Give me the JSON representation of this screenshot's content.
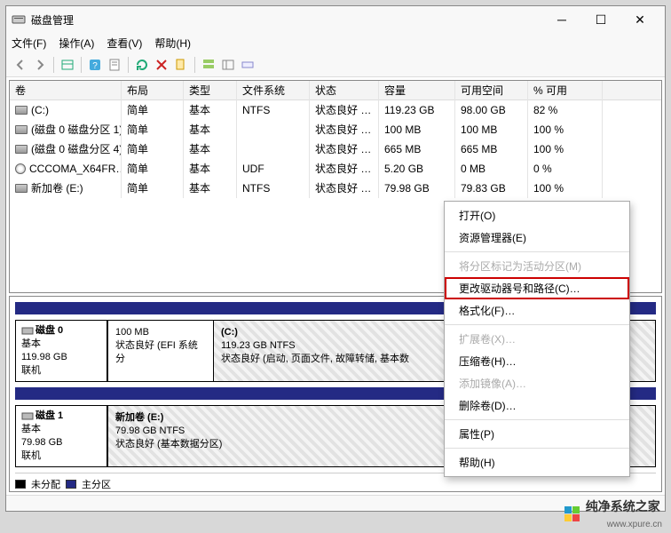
{
  "title": "磁盘管理",
  "menus": [
    "文件(F)",
    "操作(A)",
    "查看(V)",
    "帮助(H)"
  ],
  "table_headers": [
    "卷",
    "布局",
    "类型",
    "文件系统",
    "状态",
    "容量",
    "可用空间",
    "% 可用"
  ],
  "volumes": [
    {
      "icon": "drive",
      "name": "(C:)",
      "layout": "简单",
      "type": "基本",
      "fs": "NTFS",
      "status": "状态良好 (…",
      "cap": "119.23 GB",
      "free": "98.00 GB",
      "pct": "82 %"
    },
    {
      "icon": "drive",
      "name": "(磁盘 0 磁盘分区 1)",
      "layout": "简单",
      "type": "基本",
      "fs": "",
      "status": "状态良好 (…",
      "cap": "100 MB",
      "free": "100 MB",
      "pct": "100 %"
    },
    {
      "icon": "drive",
      "name": "(磁盘 0 磁盘分区 4)",
      "layout": "简单",
      "type": "基本",
      "fs": "",
      "status": "状态良好 (…",
      "cap": "665 MB",
      "free": "665 MB",
      "pct": "100 %"
    },
    {
      "icon": "cd",
      "name": "CCCOMA_X64FR…",
      "layout": "简单",
      "type": "基本",
      "fs": "UDF",
      "status": "状态良好 (…",
      "cap": "5.20 GB",
      "free": "0 MB",
      "pct": "0 %"
    },
    {
      "icon": "drive",
      "name": "新加卷 (E:)",
      "layout": "简单",
      "type": "基本",
      "fs": "NTFS",
      "status": "状态良好 (…",
      "cap": "79.98 GB",
      "free": "79.83 GB",
      "pct": "100 %"
    }
  ],
  "disks": [
    {
      "label_title": "磁盘 0",
      "label_type": "基本",
      "label_size": "119.98 GB",
      "label_status": "联机",
      "parts": [
        {
          "cls": "p1",
          "title": "",
          "sub1": "100 MB",
          "sub2": "状态良好 (EFI 系统分"
        },
        {
          "cls": "p2 hatch",
          "title": "(C:)",
          "sub1": "119.23 GB NTFS",
          "sub2": "状态良好 (启动, 页面文件, 故障转储, 基本数"
        }
      ]
    },
    {
      "label_title": "磁盘 1",
      "label_type": "基本",
      "label_size": "79.98 GB",
      "label_status": "联机",
      "parts": [
        {
          "cls": "p2 hatch",
          "title": "新加卷  (E:)",
          "sub1": "79.98 GB NTFS",
          "sub2": "状态良好 (基本数据分区)"
        }
      ]
    }
  ],
  "legend": {
    "unalloc": "未分配",
    "primary": "主分区"
  },
  "context_menu": [
    {
      "t": "打开(O)"
    },
    {
      "t": "资源管理器(E)"
    },
    {
      "sep": true
    },
    {
      "t": "将分区标记为活动分区(M)",
      "dis": true
    },
    {
      "t": "更改驱动器号和路径(C)…",
      "hl": true
    },
    {
      "t": "格式化(F)…"
    },
    {
      "sep": true
    },
    {
      "t": "扩展卷(X)…",
      "dis": true
    },
    {
      "t": "压缩卷(H)…"
    },
    {
      "t": "添加镜像(A)…",
      "dis": true
    },
    {
      "t": "删除卷(D)…"
    },
    {
      "sep": true
    },
    {
      "t": "属性(P)"
    },
    {
      "sep": true
    },
    {
      "t": "帮助(H)"
    }
  ],
  "watermark": {
    "name": "纯净系统之家",
    "url": "www.xpure.cn"
  }
}
